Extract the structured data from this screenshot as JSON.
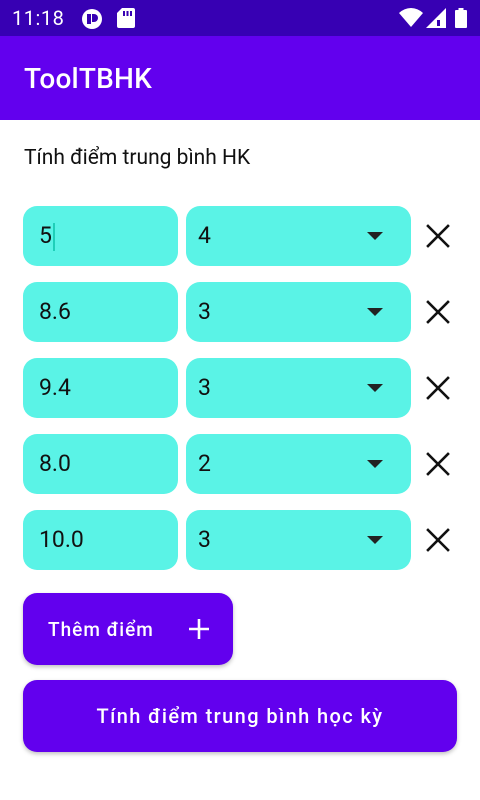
{
  "status": {
    "time": "11:18",
    "icons": [
      "vpn-icon",
      "sd-card-icon",
      "wifi-icon",
      "signal-icon",
      "battery-icon"
    ]
  },
  "app": {
    "title": "ToolTBHK"
  },
  "main": {
    "subtitle": "Tính điểm trung bình HK",
    "rows": [
      {
        "score": "5",
        "weight": "4"
      },
      {
        "score": "8.6",
        "weight": "3"
      },
      {
        "score": "9.4",
        "weight": "3"
      },
      {
        "score": "8.0",
        "weight": "2"
      },
      {
        "score": "10.0",
        "weight": "3"
      }
    ],
    "add_label": "Thêm điểm",
    "calc_label": "Tính điểm trung bình học kỳ"
  },
  "colors": {
    "status_bar": "#3700B3",
    "primary": "#6200EE",
    "field": "#5AF3E6"
  }
}
